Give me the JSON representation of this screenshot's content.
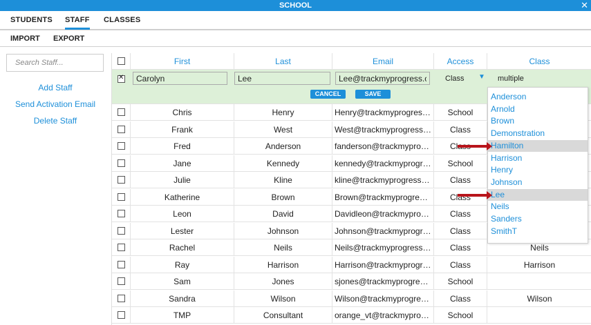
{
  "app": {
    "title": "SCHOOL",
    "close_icon": "close-icon"
  },
  "tabs": [
    "STUDENTS",
    "STAFF",
    "CLASSES"
  ],
  "active_tab": "STAFF",
  "subtabs": [
    "IMPORT",
    "EXPORT"
  ],
  "sidebar": {
    "search_placeholder": "Search Staff...",
    "links": [
      "Add Staff",
      "Send Activation Email",
      "Delete Staff"
    ]
  },
  "table": {
    "headers": [
      "First",
      "Last",
      "Email",
      "Access",
      "Class"
    ],
    "edit_row": {
      "checked": true,
      "first": "Carolyn",
      "last": "Lee",
      "email": "Lee@trackmyprogress.com",
      "access": "Class",
      "class": "multiple",
      "cancel_label": "CANCEL",
      "save_label": "SAVE"
    },
    "rows": [
      {
        "first": "Chris",
        "last": "Henry",
        "email": "Henry@trackmyprogress....",
        "access": "School",
        "class": ""
      },
      {
        "first": "Frank",
        "last": "West",
        "email": "West@trackmyprogress.c...",
        "access": "Class",
        "class": ""
      },
      {
        "first": "Fred",
        "last": "Anderson",
        "email": "fanderson@trackmyprogr...",
        "access": "Class",
        "class": ""
      },
      {
        "first": "Jane",
        "last": "Kennedy",
        "email": "kennedy@trackmyprogress...",
        "access": "School",
        "class": ""
      },
      {
        "first": "Julie",
        "last": "Kline",
        "email": "kline@trackmyprogress.c...",
        "access": "Class",
        "class": ""
      },
      {
        "first": "Katherine",
        "last": "Brown",
        "email": "Brown@trackmyprogress....",
        "access": "Class",
        "class": ""
      },
      {
        "first": "Leon",
        "last": "David",
        "email": "Davidleon@trackmyprogre...",
        "access": "Class",
        "class": ""
      },
      {
        "first": "Lester",
        "last": "Johnson",
        "email": "Johnson@trackmyprogres...",
        "access": "Class",
        "class": ""
      },
      {
        "first": "Rachel",
        "last": "Neils",
        "email": "Neils@trackmyprogress.c...",
        "access": "Class",
        "class": "Neils"
      },
      {
        "first": "Ray",
        "last": "Harrison",
        "email": "Harrison@trackmyprogres...",
        "access": "Class",
        "class": "Harrison"
      },
      {
        "first": "Sam",
        "last": "Jones",
        "email": "sjones@trackmyprogress....",
        "access": "School",
        "class": ""
      },
      {
        "first": "Sandra",
        "last": "Wilson",
        "email": "Wilson@trackmyprogress....",
        "access": "Class",
        "class": "Wilson"
      },
      {
        "first": "TMP",
        "last": "Consultant",
        "email": "orange_vt@trackmyprogress",
        "access": "School",
        "class": ""
      }
    ]
  },
  "class_dropdown": {
    "options": [
      "Anderson",
      "Arnold",
      "Brown",
      "Demonstration",
      "Hamilton",
      "Harrison",
      "Henry",
      "Johnson",
      "Lee",
      "Neils",
      "Sanders",
      "SmithT"
    ],
    "selected": [
      "Hamilton",
      "Lee"
    ]
  },
  "colors": {
    "accent": "#1d8fd9",
    "edit_row_bg": "#ddf0d8",
    "selected_option_bg": "#d9d9d9",
    "annotation_arrow": "#b8141b"
  }
}
